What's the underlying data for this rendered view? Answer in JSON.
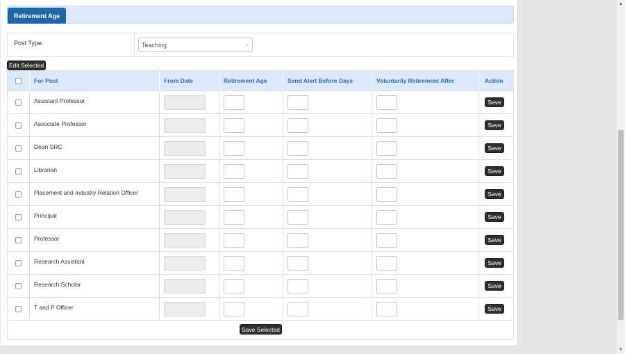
{
  "tab": {
    "title": "Retirement Age"
  },
  "filter": {
    "post_type_label": "Post Type:",
    "post_type_value": "Teaching"
  },
  "toolbar": {
    "edit_selected": "Edit Selected",
    "save_selected": "Save Selected"
  },
  "table": {
    "columns": [
      "For Post",
      "From Date",
      "Retirement Age",
      "Send Alert Before Days",
      "Voluntarily Retirement After",
      "Action"
    ],
    "save_label": "Save",
    "rows": [
      {
        "post": "Assistant Professor"
      },
      {
        "post": "Associate Professor"
      },
      {
        "post": "Dean SRC"
      },
      {
        "post": "Librarian"
      },
      {
        "post": "Placement and Industry Relation Officer"
      },
      {
        "post": "Principal"
      },
      {
        "post": "Professor"
      },
      {
        "post": "Research Assistant"
      },
      {
        "post": "Research Scholar"
      },
      {
        "post": "T and P Officer"
      }
    ]
  },
  "colors": {
    "accent": "#1f66a6",
    "header_bg": "#dce9fb",
    "header_text": "#2e6aa6",
    "button_dark": "#2f2f2f"
  }
}
